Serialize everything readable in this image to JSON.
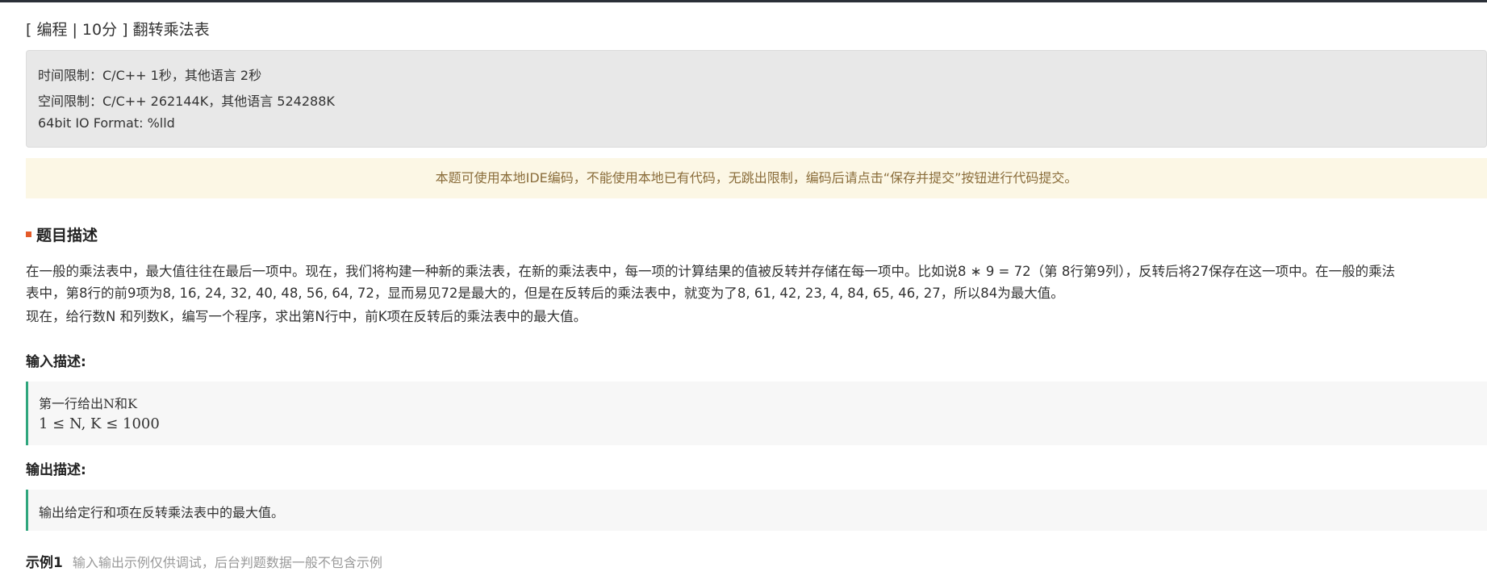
{
  "problem": {
    "title": "[ 编程 | 10分 ] 翻转乘法表",
    "limits": {
      "time": "时间限制：C/C++ 1秒，其他语言 2秒",
      "space": "空间限制：C/C++ 262144K，其他语言 524288K",
      "io_format": "64bit IO Format: %lld"
    },
    "notice": "本题可使用本地IDE编码，不能使用本地已有代码，无跳出限制，编码后请点击“保存并提交”按钮进行代码提交。",
    "description": {
      "heading": "题目描述",
      "line1": "在一般的乘法表中，最大值往往在最后一项中。现在，我们将构建一种新的乘法表，在新的乘法表中，每一项的计算结果的值被反转并存储在每一项中。比如说8 ∗ 9 = 72（第 8行第9列），反转后将27保存在这一项中。在一般的乘法",
      "line2": "表中，第8行的前9项为8, 16, 24, 32, 40, 48, 56, 64, 72，显而易见72是最大的，但是在反转后的乘法表中，就变为了8, 61, 42, 23, 4, 84, 65, 46, 27，所以84为最大值。",
      "line3": "现在，给行数N 和列数K，编写一个程序，求出第N行中，前K项在反转后的乘法表中的最大值。"
    },
    "input": {
      "heading": "输入描述:",
      "line1": "第一行给出N和K",
      "line2": "1 ≤ N, K ≤ 1000"
    },
    "output": {
      "heading": "输出描述:",
      "line1": "输出给定行和项在反转乘法表中的最大值。"
    },
    "example": {
      "label": "示例1",
      "note": "输入输出示例仅供调试，后台判题数据一般不包含示例"
    }
  }
}
